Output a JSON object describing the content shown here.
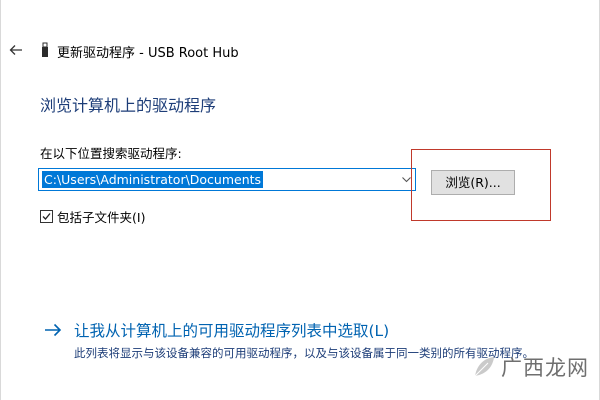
{
  "window": {
    "title": "更新驱动程序 - USB Root Hub"
  },
  "page": {
    "heading": "浏览计算机上的驱动程序"
  },
  "search": {
    "label": "在以下位置搜索驱动程序:",
    "path_value": "C:\\Users\\Administrator\\Documents",
    "browse_label": "浏览(R)...",
    "include_subfolders_label": "包括子文件夹(I)",
    "include_subfolders_checked": true
  },
  "pick": {
    "link_text": "让我从计算机上的可用驱动程序列表中选取(L)",
    "description": "此列表将显示与该设备兼容的可用驱动程序，以及与该设备属于同一类别的所有驱动程序。"
  },
  "icons": {
    "back": "back-arrow-icon",
    "device": "usb-device-icon",
    "dropdown": "chevron-down-icon",
    "check": "checkmark-icon",
    "link_arrow": "arrow-right-icon"
  },
  "colors": {
    "heading": "#1d3d78",
    "link": "#0063b1",
    "selection": "#0078d7",
    "highlight_box": "#c0392b"
  },
  "watermark": {
    "text": "广西龙网"
  }
}
